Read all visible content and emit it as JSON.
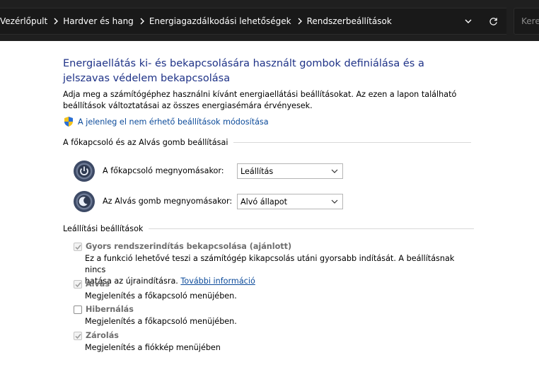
{
  "address_bar": {
    "crumbs": [
      "Vezérlőpult",
      "Hardver és hang",
      "Energiagazdálkodási lehetőségek",
      "Rendszerbeállítások"
    ],
    "search_placeholder": "Keres"
  },
  "page": {
    "title": "Energiaellátás ki- és bekapcsolására használt gombok definiálása és a jelszavas védelem bekapcsolása",
    "description": "Adja meg a számítógéphez használni kívánt energiaellátási beállításokat. Az ezen a lapon található beállítások változtatásai az összes energiasémára érvényesek.",
    "admin_link": "A jelenleg el nem érhető beállítások módosítása"
  },
  "buttons_section": {
    "heading": "A főkapcsoló és az Alvás gomb beállításai",
    "power_label": "A főkapcsoló megnyomásakor:",
    "power_value": "Leállítás",
    "sleep_label": "Az Alvás gomb megnyomásakor:",
    "sleep_value": "Alvó állapot"
  },
  "shutdown_section": {
    "heading": "Leállítási beállítások",
    "fast_startup": {
      "label": "Gyors rendszerindítás bekapcsolása (ajánlott)",
      "checked": true,
      "desc_1": "Ez a funkció lehetővé teszi a számítógép kikapcsolás utáni gyorsabb indítását. A beállításnak nincs",
      "desc_2": "hatása az újraindításra.",
      "more_link": "További információ"
    },
    "sleep": {
      "label": "Alvás",
      "checked": true,
      "desc": "Megjelenítés a főkapcsoló menüjében."
    },
    "hibernate": {
      "label": "Hibernálás",
      "checked": false,
      "desc": "Megjelenítés a főkapcsoló menüjében."
    },
    "lock": {
      "label": "Zárolás",
      "checked": true,
      "desc": "Megjelenítés a fiókkép menüjében"
    }
  }
}
